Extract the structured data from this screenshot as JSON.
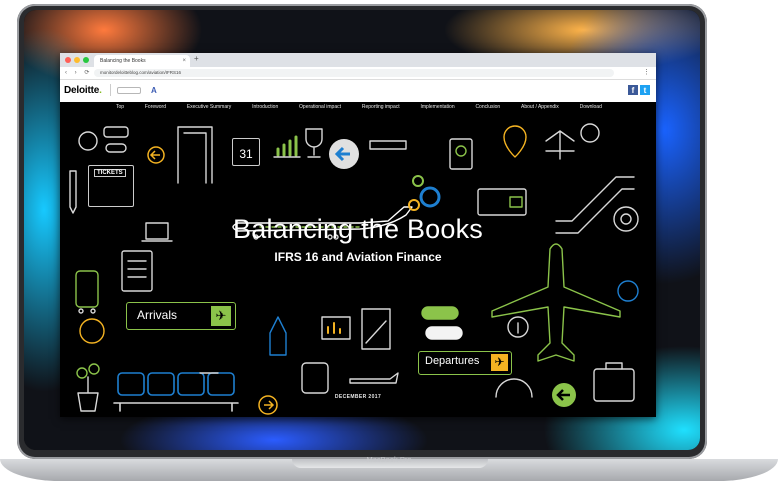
{
  "device": {
    "label": "MacBook Pro"
  },
  "browser": {
    "tab_title": "Balancing the Books",
    "new_tab": "+",
    "tab_close": "×",
    "url": "monitordeloitteblog.com/aviation/IFRS16",
    "nav_icons": "‹ › ⟳",
    "menu": "⋮"
  },
  "site": {
    "brand": "Deloitte",
    "brand_dot": ".",
    "social": {
      "facebook": "f",
      "twitter": "t"
    },
    "nav": [
      "Top",
      "Foreword",
      "Executive Summary",
      "Introduction",
      "Operational impact",
      "Reporting impact",
      "Implementation",
      "Conclusion",
      "About / Appendix",
      "Download"
    ]
  },
  "hero": {
    "title": "Balancing the Books",
    "subtitle": "IFRS 16 and Aviation Finance",
    "date": "DECEMBER 2017",
    "arrivals_label": "Arrivals",
    "departures_label": "Departures",
    "tickets_label": "TICKETS",
    "calendar_day": "31",
    "arrivals_icon": "airplane-landing-icon",
    "departures_icon": "airplane-takeoff-icon"
  },
  "colors": {
    "accent_green": "#8bc34a",
    "accent_yellow": "#f4b322",
    "accent_blue": "#1e7fd0",
    "deloitte_green": "#86bc25"
  }
}
